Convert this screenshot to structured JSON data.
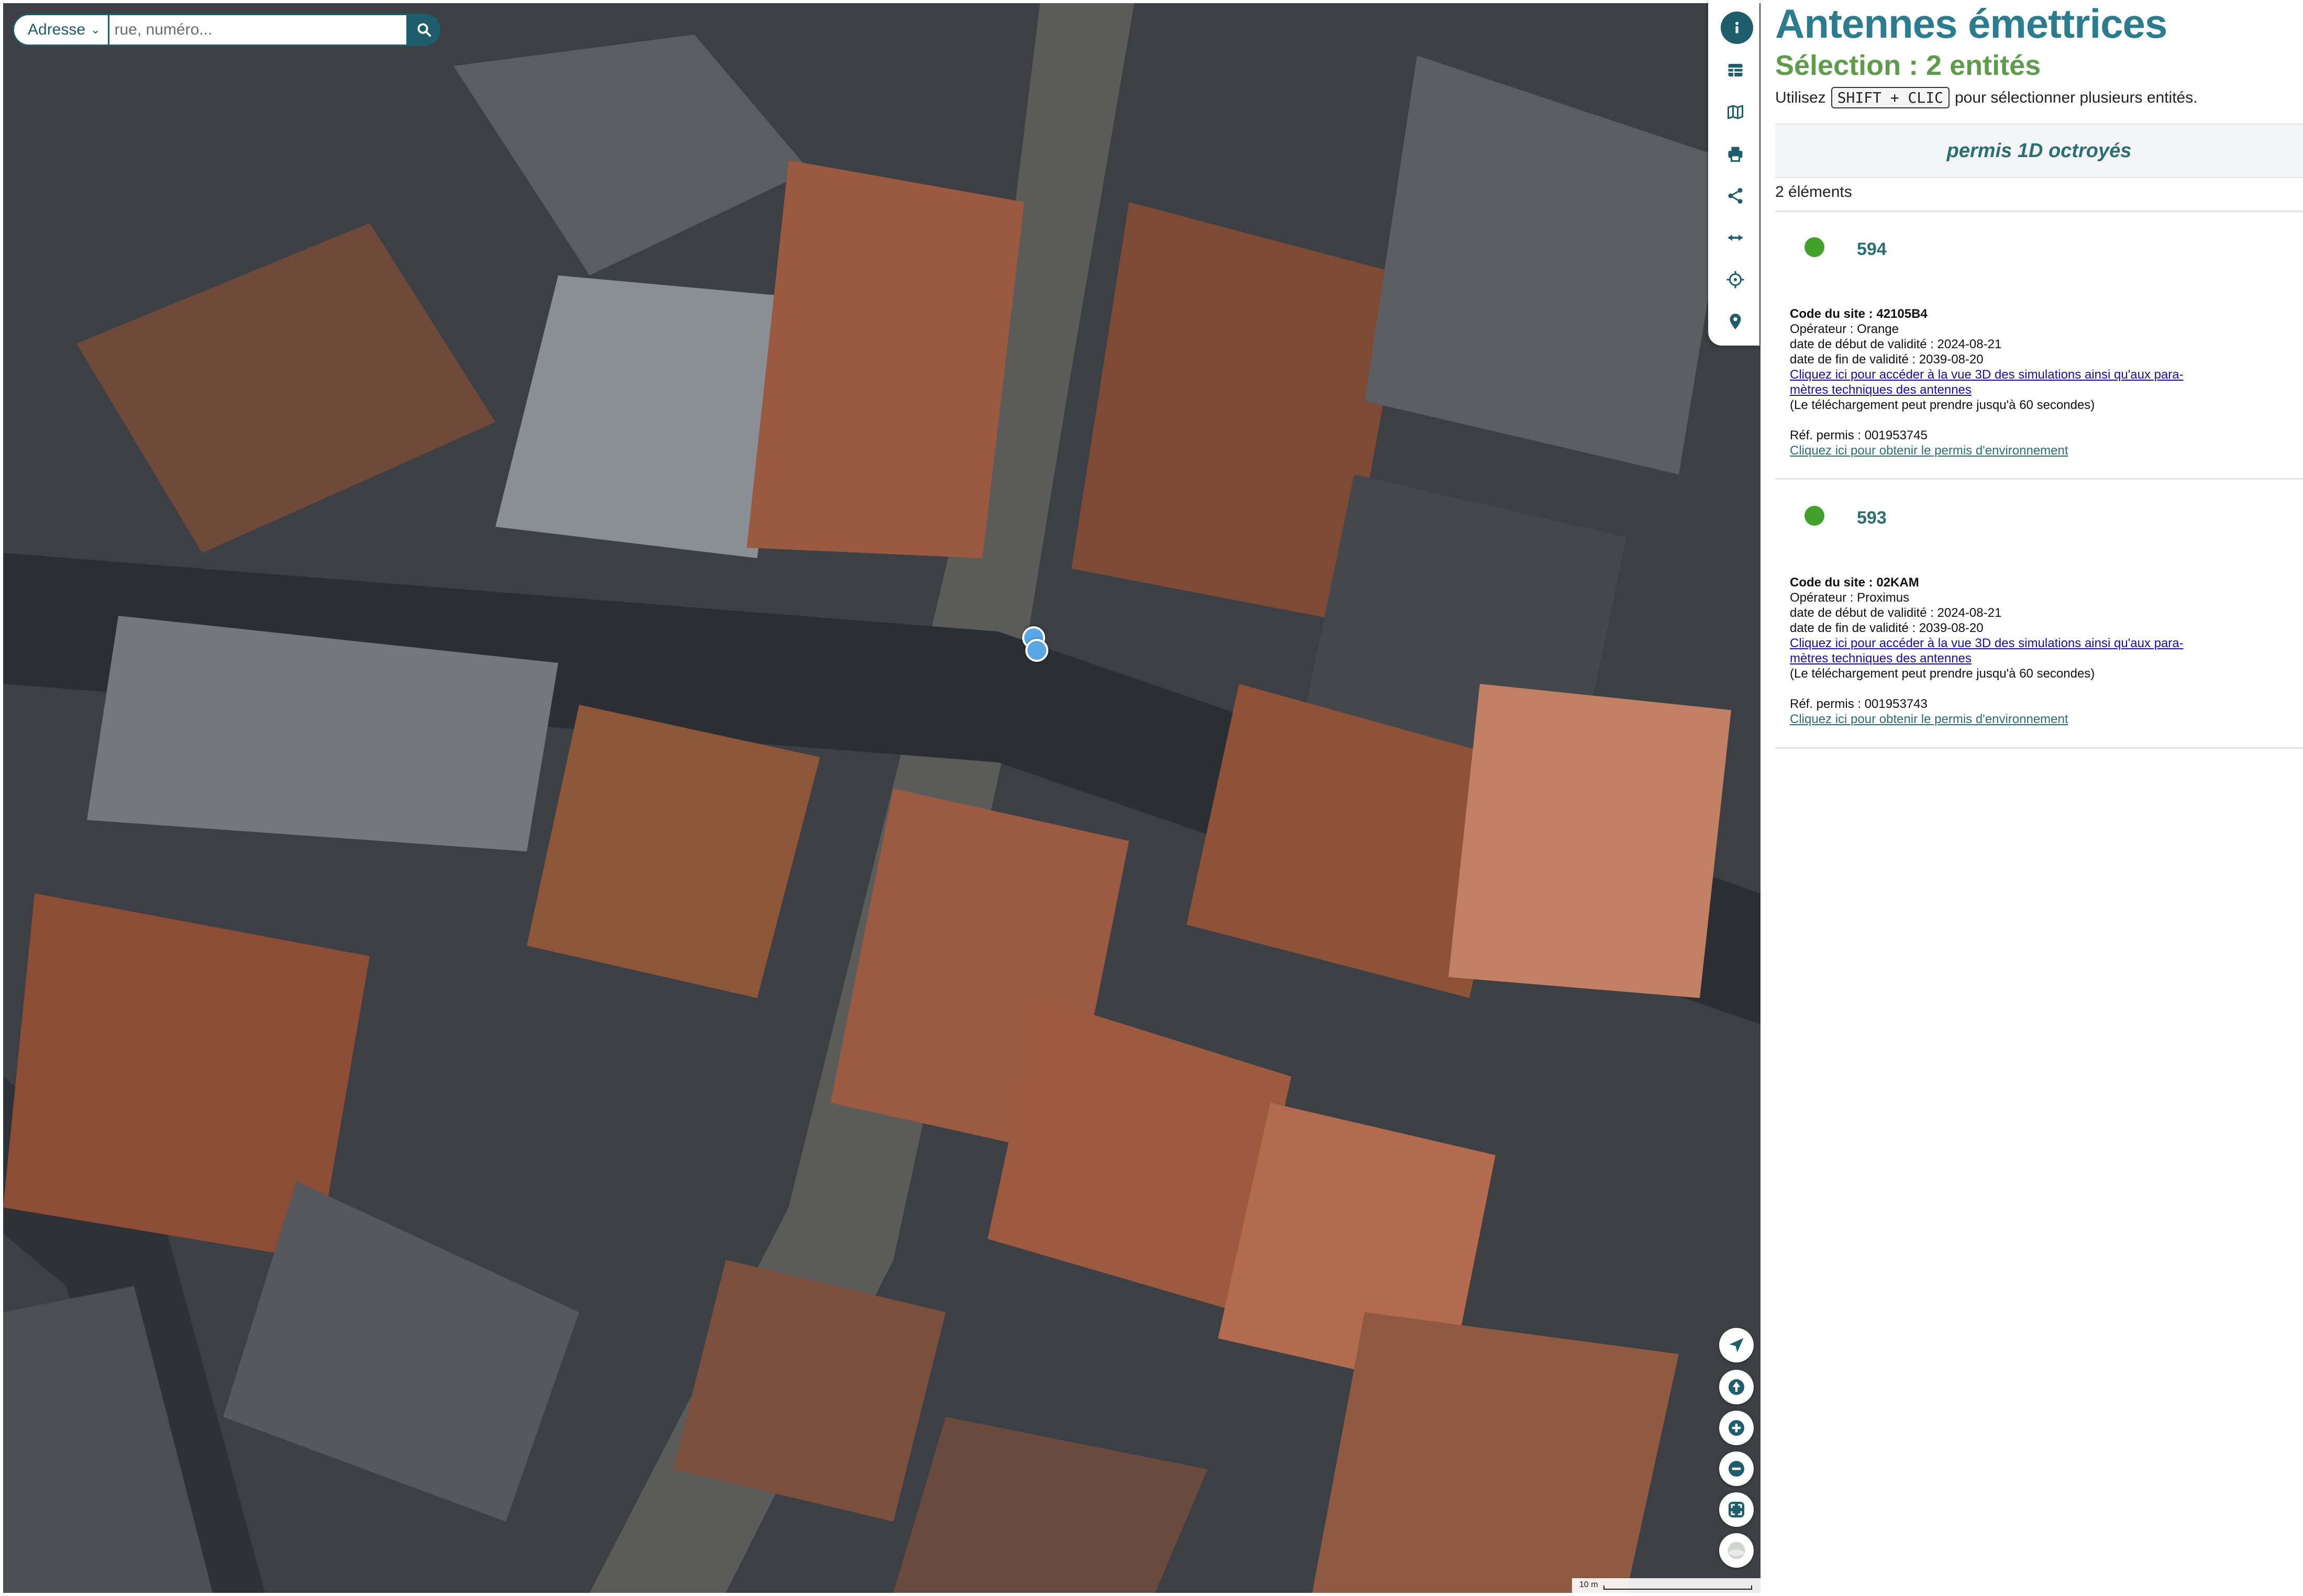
{
  "search": {
    "mode_label": "Adresse",
    "placeholder": "rue, numéro..."
  },
  "map": {
    "scale_label": "10 m",
    "basemap": "aerial orthophoto",
    "marker_color": "#5aa7e6",
    "attribution": ""
  },
  "toolbar": {
    "items": [
      "info-icon",
      "table-icon",
      "map-icon",
      "print-icon",
      "share-icon",
      "measure-icon",
      "crosshair-icon",
      "location-pin-icon"
    ]
  },
  "map_controls": [
    "navigate-icon",
    "north-arrow-icon",
    "zoom-in-icon",
    "zoom-out-icon",
    "fullscreen-icon",
    "basemap-toggle-icon"
  ],
  "panel": {
    "title": "Antennes émettrices",
    "subtitle": "Sélection : 2 entités",
    "hint_prefix": "Utilisez",
    "hint_key": "SHIFT + CLIC",
    "hint_suffix": "pour sélectionner plusieurs entités.",
    "banner": "permis 1D octroyés",
    "count": "2 éléments",
    "entities": [
      {
        "id": "594",
        "status_color": "#43a02b",
        "site_code_label": "Code du site : 42105B4",
        "operator": "Opérateur : Orange",
        "start": "date de début de validité : 2024-08-21",
        "end": "date de fin de validité : 2039-08-20",
        "link_3d_line1": "Cliquez ici pour accéder à la vue 3D des simulations ainsi qu'aux para-",
        "link_3d_line2": "mètres techniques des antennes",
        "download_note": "(Le téléchargement peut prendre jusqu'à 60 secondes)",
        "permit_ref": "Réf. permis : 001953745",
        "permit_link": "Cliquez ici pour obtenir le permis d'environnement"
      },
      {
        "id": "593",
        "status_color": "#43a02b",
        "site_code_label": "Code du site : 02KAM",
        "operator": "Opérateur : Proximus",
        "start": "date de début de validité : 2024-08-21",
        "end": "date de fin de validité : 2039-08-20",
        "link_3d_line1": "Cliquez ici pour accéder à la vue 3D des simulations ainsi qu'aux para-",
        "link_3d_line2": "mètres techniques des antennes",
        "download_note": "(Le téléchargement peut prendre jusqu'à 60 secondes)",
        "permit_ref": "Réf. permis : 001953743",
        "permit_link": "Cliquez ici pour obtenir le permis d'environnement"
      }
    ]
  }
}
